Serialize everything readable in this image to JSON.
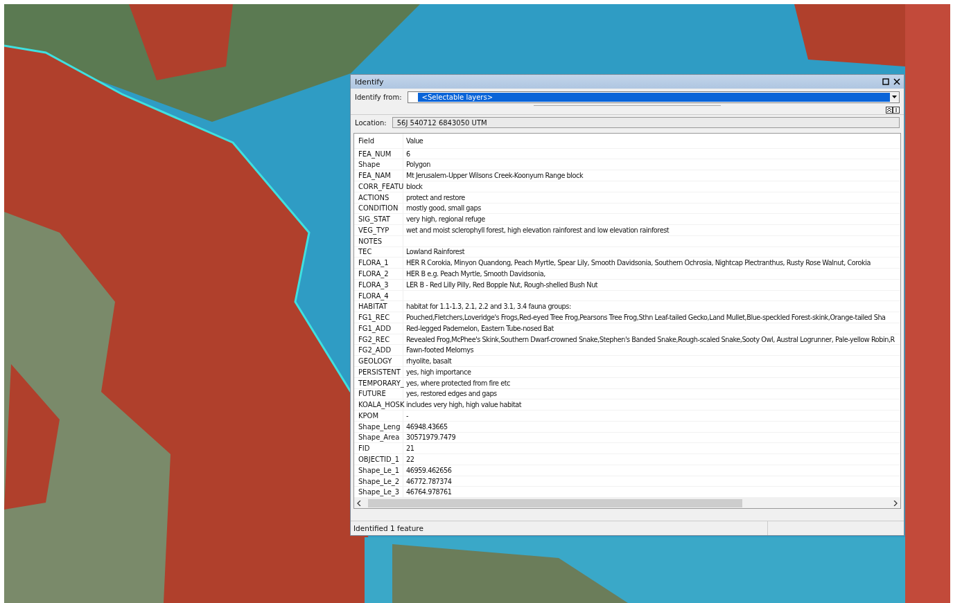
{
  "window": {
    "title": "Identify"
  },
  "identify_from": {
    "label": "Identify from:",
    "value": "<Selectable layers>"
  },
  "location": {
    "label": "Location:",
    "value": "56J 540712 6843050  UTM"
  },
  "table": {
    "columns": [
      "Field",
      "Value"
    ],
    "rows": [
      {
        "field": "FEA_NUM",
        "value": "6"
      },
      {
        "field": "Shape",
        "value": "Polygon"
      },
      {
        "field": "FEA_NAM",
        "value": "Mt Jerusalem-Upper Wilsons Creek-Koonyum Range block"
      },
      {
        "field": "CORR_FEATU",
        "value": "block"
      },
      {
        "field": "ACTIONS",
        "value": "protect and restore"
      },
      {
        "field": "CONDITION",
        "value": "mostly good, small gaps"
      },
      {
        "field": "SIG_STAT",
        "value": "very high, regional refuge"
      },
      {
        "field": "VEG_TYP",
        "value": "wet and moist sclerophyll forest, high elevation rainforest and low elevation rainforest"
      },
      {
        "field": "NOTES"
      },
      {
        "field": "TEC",
        "value": "Lowland Rainforest"
      },
      {
        "field": "FLORA_1",
        "value": "HER R Corokia, Minyon Quandong, Peach Myrtle, Spear Lily, Smooth Davidsonia, Southern Ochrosia, Nightcap Plectranthus, Rusty Rose Walnut, Corokia"
      },
      {
        "field": "FLORA_2",
        "value": "HER B e.g. Peach Myrtle, Smooth Davidsonia,"
      },
      {
        "field": "FLORA_3",
        "value": "LER B - Red Lilly Pilly, Red Bopple Nut, Rough-shelled Bush Nut"
      },
      {
        "field": "FLORA_4"
      },
      {
        "field": "HABITAT",
        "value": "habitat for 1.1-1.3, 2.1, 2.2 and 3.1, 3.4 fauna groups:"
      },
      {
        "field": "FG1_REC",
        "value": "Pouched,Fletchers,Loveridge's Frogs,Red-eyed  Tree Frog,Pearsons Tree Frog,Sthn Leaf-tailed Gecko,Land Mullet,Blue-speckled Forest-skink,Orange-tailed Sha"
      },
      {
        "field": "FG1_ADD",
        "value": "Red-legged Pademelon, Eastern Tube-nosed Bat"
      },
      {
        "field": "FG2_REC",
        "value": "Revealed Frog,McPhee's Skink,Southern Dwarf-crowned Snake,Stephen's Banded Snake,Rough-scaled Snake,Sooty Owl, Austral Logrunner, Pale-yellow Robin,R"
      },
      {
        "field": "FG2_ADD",
        "value": "Fawn-footed Melomys"
      },
      {
        "field": "GEOLOGY",
        "value": "rhyolite, basalt"
      },
      {
        "field": "PERSISTENT",
        "value": "yes, high importance"
      },
      {
        "field": "TEMPORARY_",
        "value": "yes, where protected from fire etc"
      },
      {
        "field": "FUTURE",
        "value": "yes, restored edges and gaps"
      },
      {
        "field": "KOALA_HOSK",
        "value": "includes very high, high value habitat"
      },
      {
        "field": "KPOM",
        "value": "-"
      },
      {
        "field": "Shape_Leng",
        "value": "46948.43665"
      },
      {
        "field": "Shape_Area",
        "value": "30571979.7479"
      },
      {
        "field": "FID",
        "value": "21"
      },
      {
        "field": "OBJECTID_1",
        "value": "22"
      },
      {
        "field": "Shape_Le_1",
        "value": "46959.462656"
      },
      {
        "field": "Shape_Le_2",
        "value": "46772.787374"
      },
      {
        "field": "Shape_Le_3",
        "value": "46764.978761"
      }
    ]
  },
  "status_bar": {
    "text": "Identified 1 feature"
  }
}
